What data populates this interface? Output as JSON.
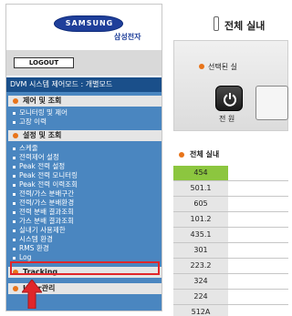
{
  "logo": {
    "brand": "SAMSUNG",
    "sub": "삼성전자"
  },
  "logout_label": "LOGOUT",
  "mode_label": "DVM 시스템 제어모드 : 개별모드",
  "menu": {
    "section1": "제어 및 조회",
    "section1_items": [
      "모니터링 및 제어",
      "고장 이력"
    ],
    "section2": "설정 및 조회",
    "section2_items": [
      "스케줄",
      "전력제어 설정",
      "Peak 전력 설정",
      "Peak 전력 모니터링",
      "Peak 전력 이력조회",
      "전력/가스 분배구간",
      "전력/가스 분배환경",
      "전력 분배 결과조회",
      "가스 분배 결과조회",
      "실내기 사용제한",
      "시스템 환경",
      "RMS 환경",
      "Log"
    ],
    "section3": "Tracking",
    "section4": "User관리"
  },
  "right": {
    "title": "전체 실내",
    "select_label": "선택된 실",
    "power_label": "전 원",
    "table_header": "전체 실내",
    "values": [
      "454",
      "501.1",
      "605",
      "101.2",
      "435.1",
      "301",
      "223.2",
      "324",
      "224",
      "512A"
    ]
  },
  "colors": {
    "menu_bg": "#4a86c0",
    "section_bg": "#e5e5e5",
    "mode_bar": "#1a4f8a",
    "highlight": "#e0262a",
    "green_cell": "#8cc63f",
    "dot": "#e8741a"
  }
}
